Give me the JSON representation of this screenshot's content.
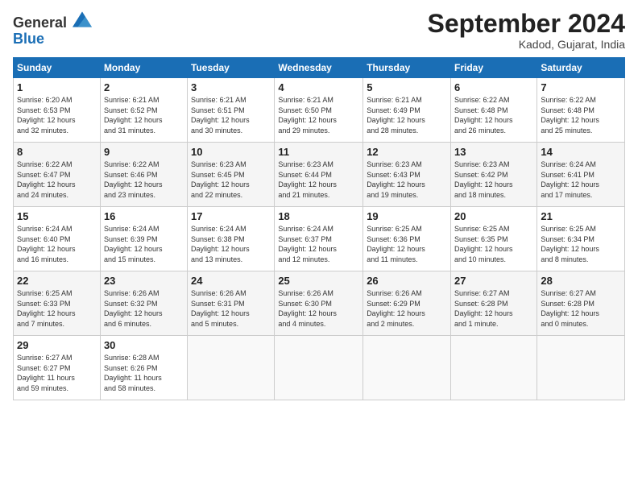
{
  "header": {
    "logo_line1": "General",
    "logo_line2": "Blue",
    "month": "September 2024",
    "location": "Kadod, Gujarat, India"
  },
  "weekdays": [
    "Sunday",
    "Monday",
    "Tuesday",
    "Wednesday",
    "Thursday",
    "Friday",
    "Saturday"
  ],
  "weeks": [
    [
      {
        "day": "1",
        "info": "Sunrise: 6:20 AM\nSunset: 6:53 PM\nDaylight: 12 hours\nand 32 minutes."
      },
      {
        "day": "2",
        "info": "Sunrise: 6:21 AM\nSunset: 6:52 PM\nDaylight: 12 hours\nand 31 minutes."
      },
      {
        "day": "3",
        "info": "Sunrise: 6:21 AM\nSunset: 6:51 PM\nDaylight: 12 hours\nand 30 minutes."
      },
      {
        "day": "4",
        "info": "Sunrise: 6:21 AM\nSunset: 6:50 PM\nDaylight: 12 hours\nand 29 minutes."
      },
      {
        "day": "5",
        "info": "Sunrise: 6:21 AM\nSunset: 6:49 PM\nDaylight: 12 hours\nand 28 minutes."
      },
      {
        "day": "6",
        "info": "Sunrise: 6:22 AM\nSunset: 6:48 PM\nDaylight: 12 hours\nand 26 minutes."
      },
      {
        "day": "7",
        "info": "Sunrise: 6:22 AM\nSunset: 6:48 PM\nDaylight: 12 hours\nand 25 minutes."
      }
    ],
    [
      {
        "day": "8",
        "info": "Sunrise: 6:22 AM\nSunset: 6:47 PM\nDaylight: 12 hours\nand 24 minutes."
      },
      {
        "day": "9",
        "info": "Sunrise: 6:22 AM\nSunset: 6:46 PM\nDaylight: 12 hours\nand 23 minutes."
      },
      {
        "day": "10",
        "info": "Sunrise: 6:23 AM\nSunset: 6:45 PM\nDaylight: 12 hours\nand 22 minutes."
      },
      {
        "day": "11",
        "info": "Sunrise: 6:23 AM\nSunset: 6:44 PM\nDaylight: 12 hours\nand 21 minutes."
      },
      {
        "day": "12",
        "info": "Sunrise: 6:23 AM\nSunset: 6:43 PM\nDaylight: 12 hours\nand 19 minutes."
      },
      {
        "day": "13",
        "info": "Sunrise: 6:23 AM\nSunset: 6:42 PM\nDaylight: 12 hours\nand 18 minutes."
      },
      {
        "day": "14",
        "info": "Sunrise: 6:24 AM\nSunset: 6:41 PM\nDaylight: 12 hours\nand 17 minutes."
      }
    ],
    [
      {
        "day": "15",
        "info": "Sunrise: 6:24 AM\nSunset: 6:40 PM\nDaylight: 12 hours\nand 16 minutes."
      },
      {
        "day": "16",
        "info": "Sunrise: 6:24 AM\nSunset: 6:39 PM\nDaylight: 12 hours\nand 15 minutes."
      },
      {
        "day": "17",
        "info": "Sunrise: 6:24 AM\nSunset: 6:38 PM\nDaylight: 12 hours\nand 13 minutes."
      },
      {
        "day": "18",
        "info": "Sunrise: 6:24 AM\nSunset: 6:37 PM\nDaylight: 12 hours\nand 12 minutes."
      },
      {
        "day": "19",
        "info": "Sunrise: 6:25 AM\nSunset: 6:36 PM\nDaylight: 12 hours\nand 11 minutes."
      },
      {
        "day": "20",
        "info": "Sunrise: 6:25 AM\nSunset: 6:35 PM\nDaylight: 12 hours\nand 10 minutes."
      },
      {
        "day": "21",
        "info": "Sunrise: 6:25 AM\nSunset: 6:34 PM\nDaylight: 12 hours\nand 8 minutes."
      }
    ],
    [
      {
        "day": "22",
        "info": "Sunrise: 6:25 AM\nSunset: 6:33 PM\nDaylight: 12 hours\nand 7 minutes."
      },
      {
        "day": "23",
        "info": "Sunrise: 6:26 AM\nSunset: 6:32 PM\nDaylight: 12 hours\nand 6 minutes."
      },
      {
        "day": "24",
        "info": "Sunrise: 6:26 AM\nSunset: 6:31 PM\nDaylight: 12 hours\nand 5 minutes."
      },
      {
        "day": "25",
        "info": "Sunrise: 6:26 AM\nSunset: 6:30 PM\nDaylight: 12 hours\nand 4 minutes."
      },
      {
        "day": "26",
        "info": "Sunrise: 6:26 AM\nSunset: 6:29 PM\nDaylight: 12 hours\nand 2 minutes."
      },
      {
        "day": "27",
        "info": "Sunrise: 6:27 AM\nSunset: 6:28 PM\nDaylight: 12 hours\nand 1 minute."
      },
      {
        "day": "28",
        "info": "Sunrise: 6:27 AM\nSunset: 6:28 PM\nDaylight: 12 hours\nand 0 minutes."
      }
    ],
    [
      {
        "day": "29",
        "info": "Sunrise: 6:27 AM\nSunset: 6:27 PM\nDaylight: 11 hours\nand 59 minutes."
      },
      {
        "day": "30",
        "info": "Sunrise: 6:28 AM\nSunset: 6:26 PM\nDaylight: 11 hours\nand 58 minutes."
      },
      {
        "day": "",
        "info": ""
      },
      {
        "day": "",
        "info": ""
      },
      {
        "day": "",
        "info": ""
      },
      {
        "day": "",
        "info": ""
      },
      {
        "day": "",
        "info": ""
      }
    ]
  ]
}
